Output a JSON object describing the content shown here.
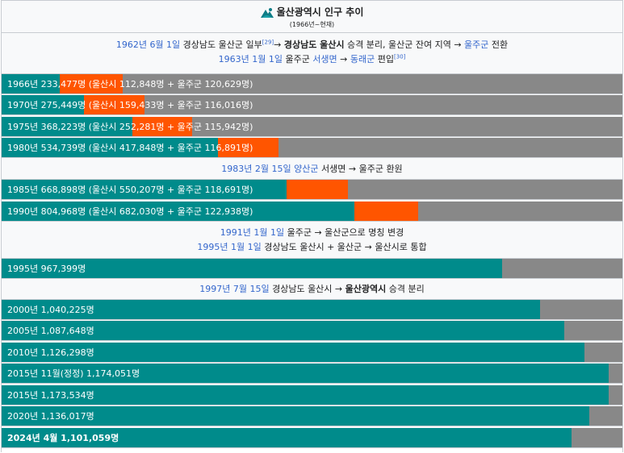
{
  "title": "울산광역시 인구 추이",
  "subtitle": "(1966년~현재)",
  "colors": {
    "teal": "#008b8b",
    "orange": "#ff5500",
    "gray": "#888888",
    "link": "#3366cc"
  },
  "notes": {
    "n1": {
      "l1_date": "1962년 6월 1일",
      "l1_text1": " 경상남도 울산군 일부",
      "l1_ref": "[29]",
      "l1_text2": "→ ",
      "l1_bold": "경상남도 울산시",
      "l1_text3": " 승격 분리, 울산군 잔여 지역 → ",
      "l1_link": "울주군",
      "l1_text4": " 전환",
      "l2_date": "1963년 1월 1일",
      "l2_text1": " 울주군 ",
      "l2_link1": "서생면",
      "l2_text2": " → ",
      "l2_link2": "동래군",
      "l2_text3": " 편입",
      "l2_ref": "[30]"
    },
    "n2": {
      "date": "1983년 2월 15일",
      "text1": " ",
      "link": "양산군",
      "text2": " 서생면 → 울주군 환원"
    },
    "n3": {
      "l1_date": "1991년 1월 1일",
      "l1_text": " 울주군 → 울산군으로 명칭 변경",
      "l2_date": "1995년 1월 1일",
      "l2_text": " 경상남도 울산시 + 울산군 → 울산시로 통합"
    },
    "n4": {
      "date": "1997년 7월 15일",
      "text1": " 경상남도 울산시 → ",
      "bold": "울산광역시",
      "text2": " 승격 분리"
    }
  },
  "rows": [
    {
      "label": "1966년 233,477명 (울산시 112,848명 + 울주군 120,629명)",
      "total": 233477,
      "city": 112848,
      "county": 120629
    },
    {
      "label": "1970년 275,449명 (울산시 159,433명 + 울주군 116,016명)",
      "total": 275449,
      "city": 159433,
      "county": 116016
    },
    {
      "label": "1975년 368,223명 (울산시 252,281명 + 울주군 115,942명)",
      "total": 368223,
      "city": 252281,
      "county": 115942
    },
    {
      "label": "1980년 534,739명 (울산시 417,848명 + 울주군 116,891명)",
      "total": 534739,
      "city": 417848,
      "county": 116891
    },
    {
      "label": "1985년 668,898명 (울산시 550,207명 + 울주군 118,691명)",
      "total": 668898,
      "city": 550207,
      "county": 118691
    },
    {
      "label": "1990년 804,968명 (울산시 682,030명 + 울주군 122,938명)",
      "total": 804968,
      "city": 682030,
      "county": 122938
    },
    {
      "label": "1995년 967,399명",
      "total": 967399,
      "city": 967399,
      "county": 0
    },
    {
      "label": "2000년 1,040,225명",
      "total": 1040225,
      "city": 1040225,
      "county": 0
    },
    {
      "label": "2005년 1,087,648명",
      "total": 1087648,
      "city": 1087648,
      "county": 0
    },
    {
      "label": "2010년 1,126,298명",
      "total": 1126298,
      "city": 1126298,
      "county": 0
    },
    {
      "label": "2015년 11월(정정) 1,174,051명",
      "total": 1174051,
      "city": 1174051,
      "county": 0
    },
    {
      "label": "2015년 1,173,534명",
      "total": 1173534,
      "city": 1173534,
      "county": 0
    },
    {
      "label": "2020년 1,136,017명",
      "total": 1136017,
      "city": 1136017,
      "county": 0
    },
    {
      "label": "2024년 4월 1,101,059명",
      "total": 1101059,
      "city": 1101059,
      "county": 0
    }
  ],
  "scale_max": 1200000
}
